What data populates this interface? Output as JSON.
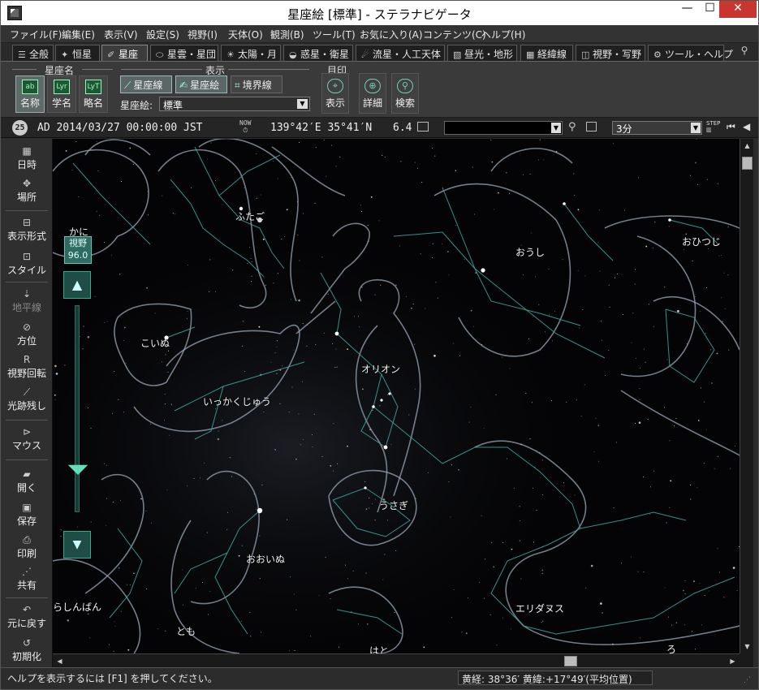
{
  "window": {
    "title": "星座絵 [標準] - ステラナビゲータ",
    "minimize": "—",
    "maximize": "☐",
    "close": "✕"
  },
  "menu": [
    "ファイル(F)",
    "編集(E)",
    "表示(V)",
    "設定(S)",
    "視野(I)",
    "天体(O)",
    "観測(B)",
    "ツール(T)",
    "お気に入り(A)",
    "コンテンツ(C)",
    "ヘルプ(H)"
  ],
  "tabs": [
    {
      "label": "全般",
      "icon": "☰"
    },
    {
      "label": "恒星",
      "icon": "✦"
    },
    {
      "label": "星座",
      "icon": "✐"
    },
    {
      "label": "星雲・星団",
      "icon": "⬭"
    },
    {
      "label": "太陽・月",
      "icon": "☀"
    },
    {
      "label": "惑星・衛星",
      "icon": "◒"
    },
    {
      "label": "流星・人工天体",
      "icon": "☄"
    },
    {
      "label": "昼光・地形",
      "icon": "▧"
    },
    {
      "label": "経緯線",
      "icon": "▦"
    },
    {
      "label": "視野・写野",
      "icon": "◫"
    },
    {
      "label": "ツール・ヘルプ",
      "icon": "⚙"
    }
  ],
  "ribbon": {
    "group_names": "星座名",
    "group_display": "表示",
    "group_mark": "目印",
    "btn_name": "名称",
    "btn_scientific": "学名",
    "btn_abbr": "略名",
    "btn_lines": "星座線",
    "btn_art": "星座絵",
    "btn_boundary": "境界線",
    "art_label": "星座絵:",
    "art_value": "標準",
    "btn_show": "表示",
    "btn_detail": "詳細",
    "btn_search": "検索"
  },
  "timebar": {
    "badge": "25",
    "datetime": "AD 2014/03/27 00:00:00 JST",
    "now": "NOW",
    "coords": "139°42′E 35°41′N",
    "mag": "6.4",
    "step": "3分",
    "step_icon": "STEP"
  },
  "sidebar": [
    {
      "label": "日時",
      "icon": "▦"
    },
    {
      "label": "場所",
      "icon": "✥"
    },
    {
      "label": "表示形式",
      "icon": "⊟"
    },
    {
      "label": "スタイル",
      "icon": "⊡"
    },
    {
      "label": "地平線",
      "icon": "⇣"
    },
    {
      "label": "方位",
      "icon": "⊘"
    },
    {
      "label": "視野回転",
      "icon": "R"
    },
    {
      "label": "光跡残し",
      "icon": "⟋"
    },
    {
      "label": "マウス",
      "icon": "⊳"
    },
    {
      "label": "開く",
      "icon": "▰"
    },
    {
      "label": "保存",
      "icon": "▣"
    },
    {
      "label": "印刷",
      "icon": "⎙"
    },
    {
      "label": "共有",
      "icon": "⋰"
    },
    {
      "label": "元に戻す",
      "icon": "↶"
    },
    {
      "label": "初期化",
      "icon": "↺"
    }
  ],
  "fov": {
    "label": "視野",
    "value": "96.0"
  },
  "constellations": [
    "かに",
    "ふたご",
    "おうし",
    "おひつじ",
    "こいぬ",
    "いっかくじゅう",
    "オリオン",
    "うさぎ",
    "おおいぬ",
    "エリダヌス",
    "とも",
    "はと",
    "らしんばん",
    "ろ"
  ],
  "status": {
    "help": "ヘルプを表示するには [F1] を押してください。",
    "ecliptic": "黄経: 38°36′ 黄緯:+17°49′(平均位置)"
  },
  "colors": {
    "sky": "#040406",
    "line": "#3fa9a0",
    "art": "#9aa6b6",
    "accent": "#2f6b60"
  }
}
